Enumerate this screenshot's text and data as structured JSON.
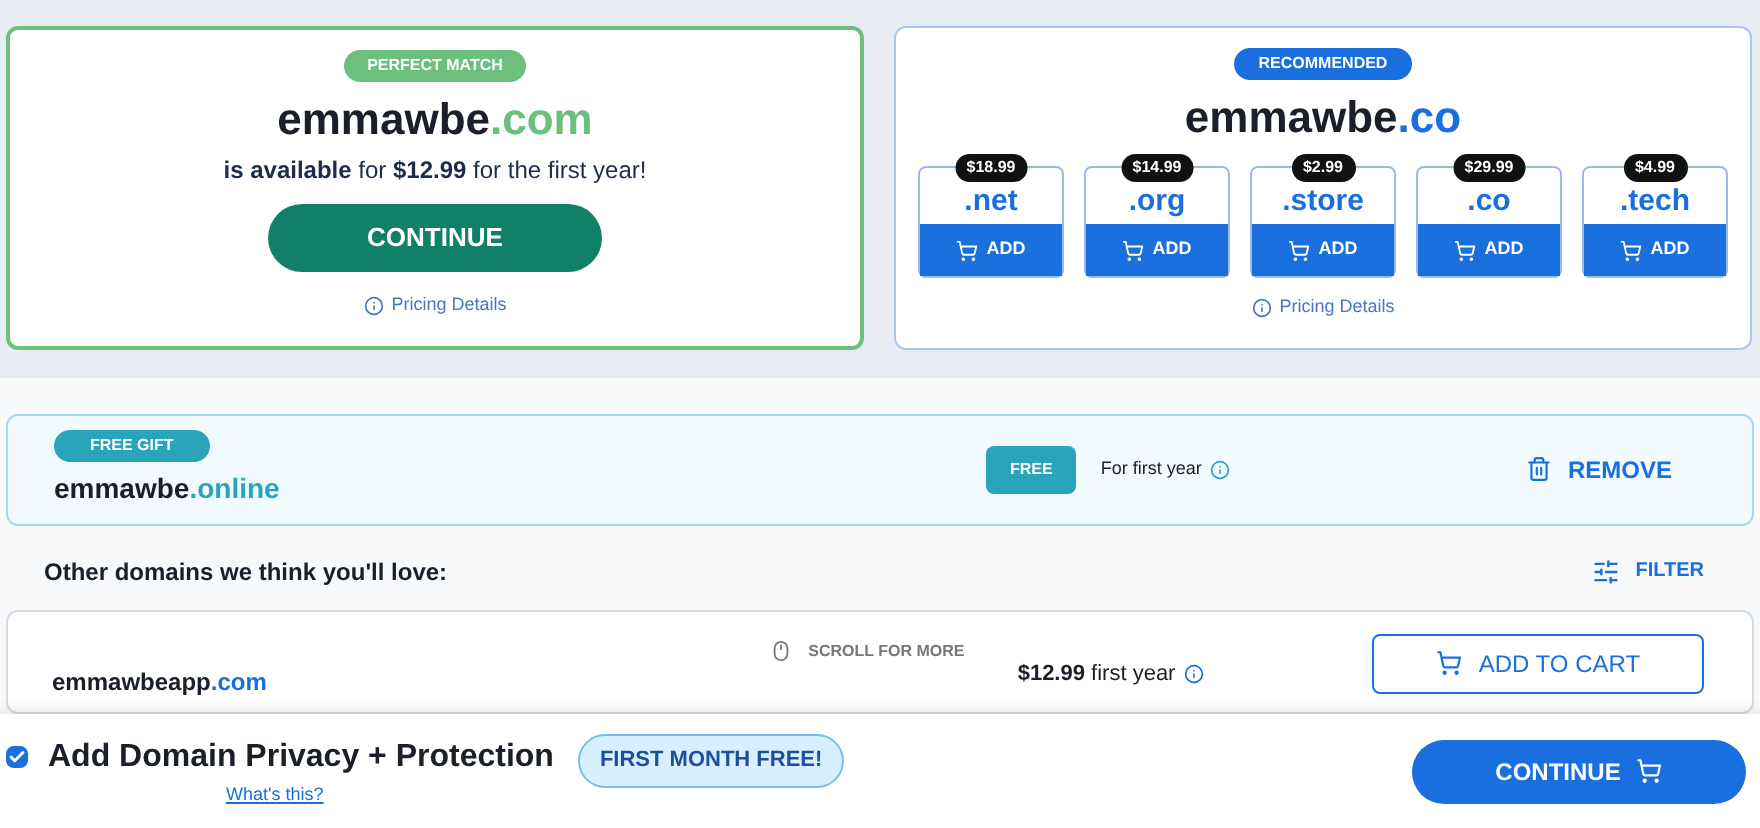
{
  "match": {
    "badge": "PERFECT MATCH",
    "name": "emmawbe",
    "tld": ".com",
    "availability": "**is available** for **$12.99** for the first year!",
    "button": "CONTINUE",
    "pricing": "Pricing Details"
  },
  "recommended": {
    "badge": "RECOMMENDED",
    "name": "emmawbe",
    "tld": ".co",
    "pricing": "Pricing Details",
    "options": [
      {
        "price": "$18.99",
        "tld": ".net",
        "button": "ADD"
      },
      {
        "price": "$14.99",
        "tld": ".org",
        "button": "ADD"
      },
      {
        "price": "$2.99",
        "tld": ".store",
        "button": "ADD"
      },
      {
        "price": "$29.99",
        "tld": ".co",
        "button": "ADD"
      },
      {
        "price": "$4.99",
        "tld": ".tech",
        "button": "ADD"
      }
    ]
  },
  "gift": {
    "badge": "FREE GIFT",
    "name": "emmawbe",
    "tld": ".online",
    "price_badge": "FREE",
    "term": "For first year",
    "remove": "REMOVE"
  },
  "other": {
    "heading": "Other domains we think you'll love:",
    "filter": "FILTER",
    "scroll_hint": "SCROLL FOR MORE",
    "rows": [
      {
        "name": "emmawbeapp",
        "tld": ".com",
        "price": "$12.99",
        "term": "first year",
        "button": "ADD TO CART"
      }
    ]
  },
  "footer": {
    "privacy_checked": true,
    "privacy": "Add Domain Privacy + Protection",
    "whats_this": "What's this?",
    "offer": "FIRST MONTH FREE!",
    "continue": "CONTINUE"
  }
}
